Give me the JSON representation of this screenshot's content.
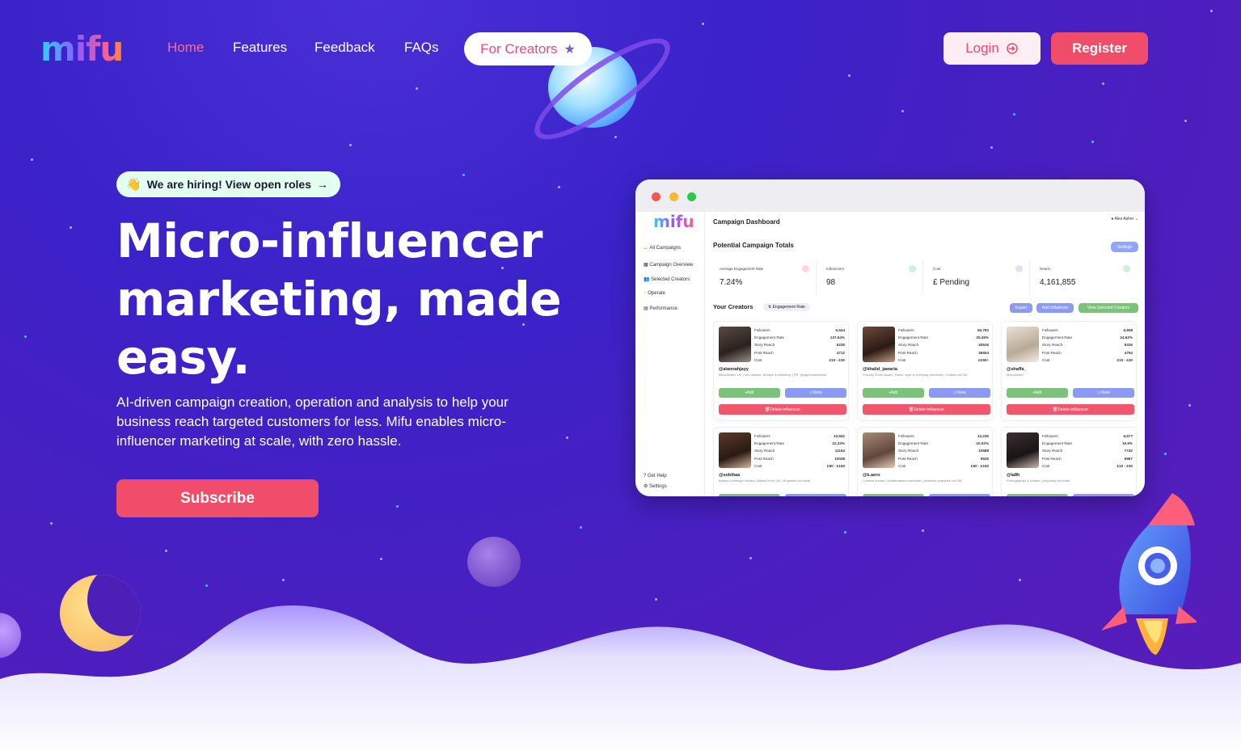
{
  "brand": {
    "logo": "mifu"
  },
  "nav": {
    "links": [
      "Home",
      "Features",
      "Feedback",
      "FAQs"
    ],
    "creators_label": "For Creators",
    "login_label": "Login",
    "register_label": "Register"
  },
  "hero": {
    "hiring_text": "We are hiring! View open roles",
    "title": "Micro-influencer marketing, made easy.",
    "description": "AI-driven campaign creation, operation and analysis to help your business reach targeted customers for less. Mifu enables micro-influencer marketing at scale, with zero hassle.",
    "subscribe_label": "Subscribe"
  },
  "dashboard": {
    "logo": "mifu",
    "title": "Campaign Dashboard",
    "user": "Alex Asher",
    "sidebar": [
      "All Campaigns",
      "Campaign Overview",
      "Selected Creators",
      "Operate",
      "Performance",
      "Get Help",
      "Settings"
    ],
    "totals_label": "Potential Campaign Totals",
    "settings_label": "Settings",
    "stats": [
      {
        "label": "Average Engagement Rate",
        "value": "7.24%"
      },
      {
        "label": "Influencers",
        "value": "98"
      },
      {
        "label": "Cost",
        "value": "£ Pending"
      },
      {
        "label": "Reach",
        "value": "4,161,855"
      }
    ],
    "creators_label": "Your Creators",
    "sort_label": "Engagement Rate",
    "export_label": "Export",
    "add_influencer_label": "Add Influencer",
    "view_selected_label": "View Selected Creators",
    "stat_labels": [
      "Followers",
      "Engagement Rate",
      "Story Reach",
      "Post Reach",
      "Cost"
    ],
    "add_label": "Add",
    "view_label": "View",
    "delete_label": "Delete Influencer",
    "cards": [
      {
        "handle": "@alannahjayy",
        "bio": "Manchester, UK | Into fashion, lifestyle & wellbeing | PR: @agentmadeleine",
        "values": [
          "6,544",
          "137.64%",
          "5235",
          "4712",
          "£10 - £30"
        ]
      },
      {
        "handle": "@khalid_jawaria",
        "bio": "Proudly South Asian | Travel, style & everyday moments | Collabs via DM",
        "values": [
          "50,783",
          "25.49%",
          "40626",
          "36564",
          "£150+"
        ]
      },
      {
        "handle": "@shaffa_",
        "bio": "Manchester",
        "values": [
          "6,658",
          "24.62%",
          "5326",
          "4794",
          "£10 - £30"
        ]
      },
      {
        "handle": "@sobihaa",
        "bio": "Beauty & lifestyle creator | Based in the UK | Enquiries via email",
        "values": [
          "13,942",
          "22.33%",
          "11154",
          "10038",
          "£50 - £150"
        ]
      },
      {
        "handle": "@k.aero",
        "bio": "Content creator | collaborations welcome | business enquiries via DM",
        "values": [
          "13,235",
          "20.02%",
          "10588",
          "9529",
          "£50 - £150"
        ]
      },
      {
        "handle": "@la8h",
        "bio": "Photographer & creator | enquiries via email",
        "values": [
          "9,677",
          "19.9%",
          "7742",
          "6967",
          "£10 - £30"
        ]
      }
    ]
  }
}
